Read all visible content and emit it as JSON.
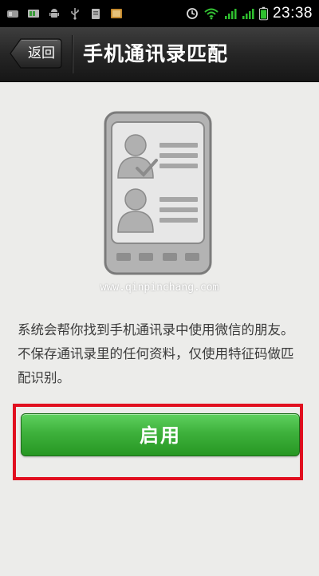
{
  "status_bar": {
    "time": "23:38",
    "icons": [
      "sim-card-icon",
      "battery-pack-icon",
      "android-icon",
      "usb-icon",
      "clipboard-icon",
      "image-notification-icon",
      "sync-icon",
      "wifi-icon",
      "signal-icon",
      "signal-icon",
      "battery-icon"
    ]
  },
  "title_bar": {
    "back_label": "返回",
    "title": "手机通讯录匹配"
  },
  "content": {
    "illustration_icon": "phone-contacts-icon",
    "watermark": "www.qinpinchang.com",
    "description": "系统会帮你找到手机通讯录中使用微信的朋友。不保存通讯录里的任何资料，仅使用特征码做匹配识别。",
    "enable_button_label": "启用"
  },
  "colors": {
    "status_bar_bg": "#000000",
    "title_bar_bg": "#262626",
    "content_bg": "#ececea",
    "button_green": "#3eb13c",
    "highlight_red": "#e10f1f",
    "accent_green_signal": "#2fbf2f"
  }
}
